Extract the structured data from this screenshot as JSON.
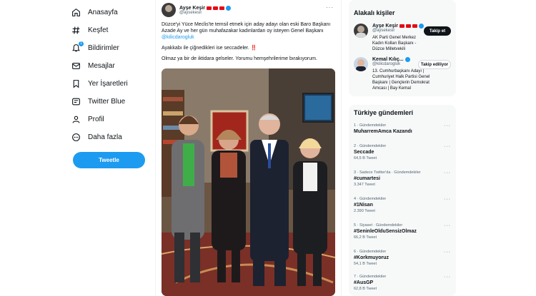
{
  "nav": {
    "items": [
      {
        "label": "Anasayfa",
        "icon": "home-icon"
      },
      {
        "label": "Keşfet",
        "icon": "hashtag-icon"
      },
      {
        "label": "Bildirimler",
        "icon": "bell-icon",
        "badge": "1"
      },
      {
        "label": "Mesajlar",
        "icon": "mail-icon"
      },
      {
        "label": "Yer İşaretleri",
        "icon": "bookmark-icon"
      },
      {
        "label": "Twitter Blue",
        "icon": "twitter-blue-icon"
      },
      {
        "label": "Profil",
        "icon": "profile-icon"
      },
      {
        "label": "Daha fazla",
        "icon": "more-circle-icon"
      }
    ],
    "tweet_button": "Tweetle"
  },
  "tweet": {
    "display_name": "Ayşe Keşir",
    "handle": "@aysekesir",
    "text_1a": "Düzce'yi Yüce Meclis'te temsil etmek için aday adayı olan eski Baro Başkanı Azade Ay ve her gün muhafazakar kadınlardan oy isteyen Genel Başkanı ",
    "mention": "@kilicdarogluk",
    "text_2": "Ayakkabı ile çiğnedikleri ise seccadeler. ‼️",
    "text_3": "Olmaz ya bir de iktidara gelseler. Yorumu hemşehrilerime bırakıyorum."
  },
  "who_to_follow": {
    "title": "Alakalı kişiler",
    "people": [
      {
        "name": "Ayşe Keşir",
        "handle": "@aysekesir",
        "bio": "AK Parti Genel Merkez Kadın Kolları Başkanı - Düzce Milletvekili",
        "button": "Takip et"
      },
      {
        "name": "Kemal Kılıç...",
        "handle": "@kilicdarogluk",
        "bio": "13. Cumhurbaşkanı Adayı | Cumhuriyet Halk Partisi Genel Başkanı | Gençlerin Demokrat Amcası | Bay Kemal",
        "button": "Takip ediliyor"
      }
    ]
  },
  "trends": {
    "title": "Türkiye gündemleri",
    "items": [
      {
        "context": "1 · Gündemdekiler",
        "name": "MuharremAmca Kazandı",
        "count": ""
      },
      {
        "context": "2 · Gündemdekiler",
        "name": "Seccade",
        "count": "64,5 B Tweet"
      },
      {
        "context": "3 · Sadece Twitter'da · Gündemdekiler",
        "name": "#cumartesi",
        "count": "3.347 Tweet"
      },
      {
        "context": "4 · Gündemdekiler",
        "name": "#1Nisan",
        "count": "2.390 Tweet"
      },
      {
        "context": "5 · Siyaset · Gündemdekiler",
        "name": "#SeninleOlduSensizOlmaz",
        "count": "66,2 B Tweet"
      },
      {
        "context": "6 · Gündemdekiler",
        "name": "#Korkmuyoruz",
        "count": "54,1 B Tweet"
      },
      {
        "context": "7 · Gündemdekiler",
        "name": "#AusGP",
        "count": "62,8 B Tweet"
      }
    ]
  },
  "colors": {
    "accent": "#1d9bf0",
    "text": "#0f1419",
    "muted": "#536471"
  }
}
